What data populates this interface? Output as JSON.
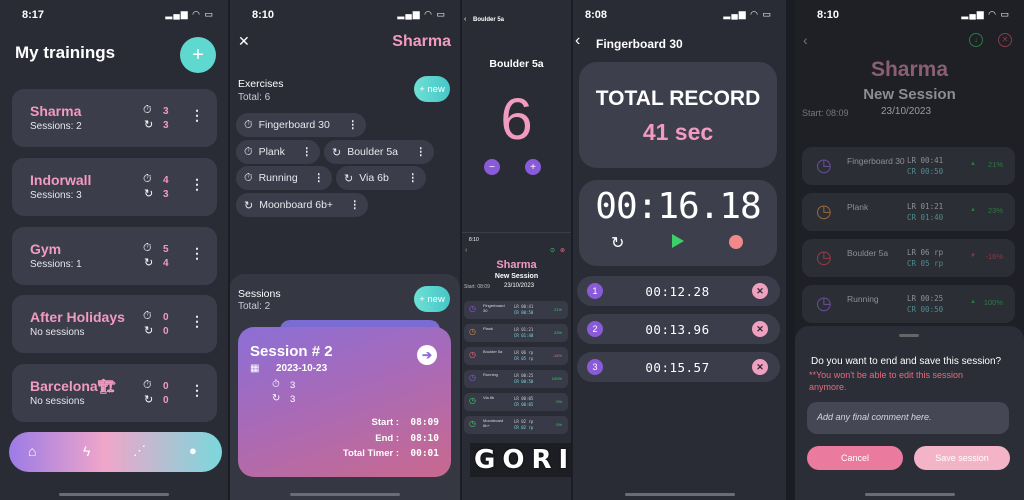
{
  "screen1": {
    "time": "8:17",
    "title": "My trainings",
    "add_label": "+",
    "trainings": [
      {
        "name": "Sharma",
        "sessions": "Sessions: 2",
        "stat1": "3",
        "stat2": "3"
      },
      {
        "name": "Indorwall",
        "sessions": "Sessions: 3",
        "stat1": "4",
        "stat2": "3"
      },
      {
        "name": "Gym",
        "sessions": "Sessions: 1",
        "stat1": "5",
        "stat2": "4"
      },
      {
        "name": "After Holidays",
        "sessions": "No sessions",
        "stat1": "0",
        "stat2": "0"
      },
      {
        "name": "Barcelona🏗",
        "sessions": "No sessions",
        "stat1": "0",
        "stat2": "0"
      }
    ],
    "nav": [
      "home-icon",
      "bolt-icon",
      "chart-icon",
      "user-icon"
    ]
  },
  "screen2": {
    "time": "8:10",
    "title": "Sharma",
    "exercises_label": "Exercises",
    "exercises_total": "Total: 6",
    "new_label": "+ new",
    "exercises": [
      "Fingerboard 30",
      "Plank",
      "Boulder 5a",
      "Running",
      "Via 6b",
      "Moonboard 6b+"
    ],
    "sessions_label": "Sessions",
    "sessions_total": "Total: 2",
    "session_card": {
      "title": "Session # 2",
      "date": "2023-10-23",
      "stat1": "3",
      "stat2": "3",
      "start_label": "Start :",
      "start": "08:09",
      "end_label": "End :",
      "end": "08:10",
      "total_label": "Total Timer :",
      "total": "00:01"
    }
  },
  "screen3": {
    "back_title": "Boulder 5a",
    "title": "Boulder 5a",
    "count": "6",
    "minus": "−",
    "plus": "+",
    "mini_time": "8:10",
    "mini_title": "Sharma",
    "mini_subtitle": "New Session",
    "mini_start": "Start: 08:09",
    "mini_date": "23/10/2023",
    "mini_rows": [
      {
        "name": "Fingerboard 30",
        "lr": "LR 00:41",
        "cr": "CR 00:50",
        "pct": "21%"
      },
      {
        "name": "Plank",
        "lr": "LR 01:21",
        "cr": "CR 01:40",
        "pct": "23%"
      },
      {
        "name": "Boulder 5a",
        "lr": "LR 06 rp",
        "cr": "CR 05 rp",
        "pct": "-16%"
      },
      {
        "name": "Running",
        "lr": "LR 00:25",
        "cr": "CR 00:50",
        "pct": "100%"
      },
      {
        "name": "Via 6b",
        "lr": "LR 00:05",
        "cr": "CR 00:05",
        "pct": "0%"
      },
      {
        "name": "Moonboard 6b+",
        "lr": "LR 02 rp",
        "cr": "CR 02 rp",
        "pct": "0%"
      }
    ],
    "watermark": "GORILLAGRAB"
  },
  "screen4": {
    "time": "8:08",
    "title": "Fingerboard 30",
    "record_label": "TOTAL RECORD",
    "record_value": "41 sec",
    "timer": "00:16.18",
    "laps": [
      {
        "n": "1",
        "t": "00:12.28"
      },
      {
        "n": "2",
        "t": "00:13.96"
      },
      {
        "n": "3",
        "t": "00:15.57"
      }
    ]
  },
  "screen5": {
    "time": "8:10",
    "title": "Sharma",
    "subtitle": "New Session",
    "start": "Start: 08:09",
    "date": "23/10/2023",
    "rows": [
      {
        "name": "Fingerboard 30",
        "lr": "LR 00:41",
        "cr": "CR 00:50",
        "pct": "21%"
      },
      {
        "name": "Plank",
        "lr": "LR 01:21",
        "cr": "CR 01:40",
        "pct": "23%"
      },
      {
        "name": "Boulder 5a",
        "lr": "LR 06 rp",
        "cr": "CR 05 rp",
        "pct": "-16%"
      },
      {
        "name": "Running",
        "lr": "LR 00:25",
        "cr": "CR 00:50",
        "pct": "100%"
      }
    ],
    "dialog_question": "Do you want to end and save this session?",
    "dialog_warning": "**You won't be able to edit this session anymore.",
    "comment_placeholder": "Add any final comment here.",
    "cancel_label": "Cancel",
    "save_label": "Save session"
  },
  "colors": {
    "accent_pink": "#f29bc1",
    "accent_teal": "#5fd8d0",
    "purple": "#8a5bd8",
    "green": "#3ccf6a",
    "red": "#e86b7c"
  }
}
